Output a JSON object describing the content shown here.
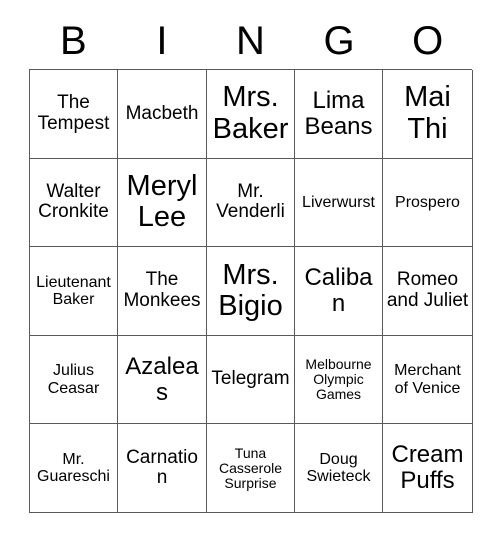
{
  "card": {
    "title_letters": [
      "B",
      "I",
      "N",
      "G",
      "O"
    ],
    "columns": 5,
    "rows": 5,
    "grid": [
      [
        {
          "text": "The Tempest",
          "size": "md"
        },
        {
          "text": "Macbeth",
          "size": "md"
        },
        {
          "text": "Mrs. Baker",
          "size": "xl"
        },
        {
          "text": "Lima Beans",
          "size": "lg"
        },
        {
          "text": "Mai Thi",
          "size": "xl"
        }
      ],
      [
        {
          "text": "Walter Cronkite",
          "size": "md"
        },
        {
          "text": "Meryl Lee",
          "size": "xl"
        },
        {
          "text": "Mr. Venderli",
          "size": "md"
        },
        {
          "text": "Liverwurst",
          "size": "sm"
        },
        {
          "text": "Prospero",
          "size": "sm"
        }
      ],
      [
        {
          "text": "Lieutenant Baker",
          "size": "sm"
        },
        {
          "text": "The Monkees",
          "size": "md"
        },
        {
          "text": "Mrs. Bigio",
          "size": "xl"
        },
        {
          "text": "Caliban",
          "size": "lg"
        },
        {
          "text": "Romeo and Juliet",
          "size": "md"
        }
      ],
      [
        {
          "text": "Julius Ceasar",
          "size": "sm"
        },
        {
          "text": "Azaleas",
          "size": "lg"
        },
        {
          "text": "Telegram",
          "size": "md"
        },
        {
          "text": "Melbourne Olympic Games",
          "size": "xs"
        },
        {
          "text": "Merchant of Venice",
          "size": "sm"
        }
      ],
      [
        {
          "text": "Mr. Guareschi",
          "size": "sm"
        },
        {
          "text": "Carnation",
          "size": "md"
        },
        {
          "text": "Tuna Casserole Surprise",
          "size": "xs"
        },
        {
          "text": "Doug Swieteck",
          "size": "sm"
        },
        {
          "text": "Cream Puffs",
          "size": "lg"
        }
      ]
    ]
  },
  "colors": {
    "background": "#ffffff",
    "text": "#000000",
    "grid_line": "#595959"
  }
}
